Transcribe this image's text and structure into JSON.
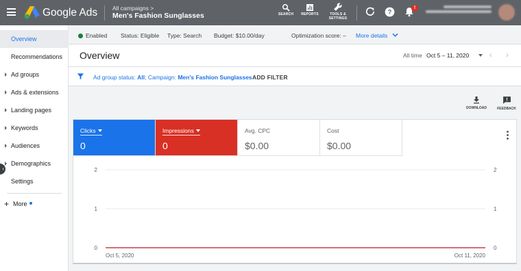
{
  "topbar": {
    "brand": "Google Ads",
    "breadcrumb": "All campaigns",
    "breadcrumb_arrow": ">",
    "campaign": "Men's Fashion Sunglasses",
    "tools": [
      {
        "label": "SEARCH",
        "icon": "search-icon"
      },
      {
        "label": "REPORTS",
        "icon": "bar-chart-icon"
      },
      {
        "label": "TOOLS &",
        "label2": "SETTINGS",
        "icon": "wrench-icon"
      }
    ],
    "notification_badge": "!"
  },
  "sidebar": {
    "items": [
      {
        "label": "Overview",
        "active": true,
        "expandable": false
      },
      {
        "label": "Recommendations",
        "active": false,
        "expandable": false
      },
      {
        "label": "Ad groups",
        "active": false,
        "expandable": true
      },
      {
        "label": "Ads & extensions",
        "active": false,
        "expandable": true
      },
      {
        "label": "Landing pages",
        "active": false,
        "expandable": true
      },
      {
        "label": "Keywords",
        "active": false,
        "expandable": true
      },
      {
        "label": "Audiences",
        "active": false,
        "expandable": true
      },
      {
        "label": "Demographics",
        "active": false,
        "expandable": true
      },
      {
        "label": "Settings",
        "active": false,
        "expandable": false
      }
    ],
    "more_label": "More"
  },
  "status": {
    "enabled": "Enabled",
    "status_label": "Status:",
    "status_value": "Eligible",
    "type_label": "Type:",
    "type_value": "Search",
    "budget_label": "Budget:",
    "budget_value": "$10.00/day",
    "opt_label": "Optimization score:",
    "opt_value": "–",
    "more_details": "More details"
  },
  "overview": {
    "title": "Overview",
    "date_label": "All time",
    "date_range": "Oct 5 – 11, 2020"
  },
  "filter": {
    "prefix": "Ad group status: ",
    "prefix_value": "All",
    "campaign_label": "; Campaign: ",
    "campaign_value": "Men's Fashion Sunglasses",
    "add_filter": "ADD FILTER"
  },
  "actions": {
    "download": "DOWNLOAD",
    "feedback": "FEEDBACK"
  },
  "metrics": [
    {
      "label": "Clicks",
      "value": "0",
      "style": "blue",
      "selectable": true
    },
    {
      "label": "Impressions",
      "value": "0",
      "style": "red",
      "selectable": true
    },
    {
      "label": "Avg. CPC",
      "value": "$0.00",
      "style": "plain",
      "selectable": false
    },
    {
      "label": "Cost",
      "value": "$0.00",
      "style": "plain",
      "selectable": false
    }
  ],
  "colors": {
    "accent": "#1a73e8",
    "impressions": "#d93025",
    "enabled": "#188038"
  },
  "chart_data": {
    "type": "line",
    "x": [
      "Oct 5, 2020",
      "Oct 11, 2020"
    ],
    "x_tick_labels": [
      "Oct 5, 2020",
      "Oct 11, 2020"
    ],
    "series": [
      {
        "name": "Clicks",
        "values": [
          0,
          0
        ],
        "color": "#1a73e8",
        "axis": "left"
      },
      {
        "name": "Impressions",
        "values": [
          0,
          0
        ],
        "color": "#d93025",
        "axis": "right"
      }
    ],
    "left_axis": {
      "ticks": [
        0,
        1,
        2
      ],
      "ylim": [
        0,
        2
      ]
    },
    "right_axis": {
      "ticks": [
        0,
        1,
        2
      ],
      "ylim": [
        0,
        2
      ]
    },
    "grid": true
  }
}
